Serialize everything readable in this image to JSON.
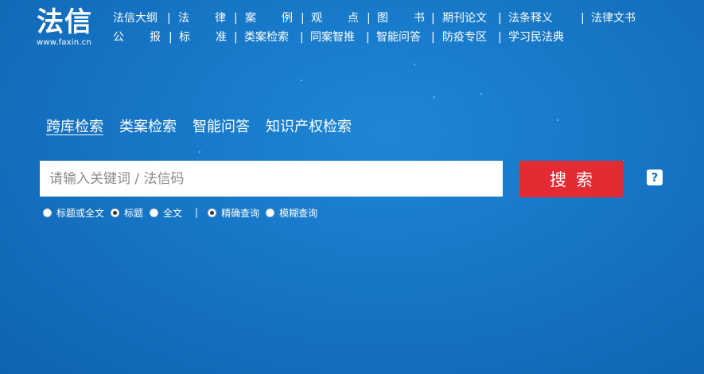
{
  "logo": {
    "title": "法信",
    "url": "www.faxin.cn"
  },
  "nav": {
    "row1": [
      {
        "label": "法信大纲",
        "sep": "|"
      },
      {
        "label": "法",
        "sep": ""
      },
      {
        "label": "律",
        "sep": "|"
      },
      {
        "label": "案",
        "sep": ""
      },
      {
        "label": "例",
        "sep": "|"
      },
      {
        "label": "观",
        "sep": ""
      },
      {
        "label": "点",
        "sep": "|"
      },
      {
        "label": "图",
        "sep": ""
      },
      {
        "label": "书",
        "sep": "|"
      },
      {
        "label": "期刊论文",
        "sep": "|"
      },
      {
        "label": "法条释义",
        "sep": "|"
      },
      {
        "label": "法律文书",
        "sep": ""
      }
    ],
    "row2": [
      {
        "label": "公",
        "sep": ""
      },
      {
        "label": "报",
        "sep": "|"
      },
      {
        "label": "标",
        "sep": ""
      },
      {
        "label": "准",
        "sep": "|"
      },
      {
        "label": "类案检索",
        "sep": "|"
      },
      {
        "label": "同案智推",
        "sep": "|"
      },
      {
        "label": "智能问答",
        "sep": "|"
      },
      {
        "label": "防疫专区",
        "sep": "|"
      },
      {
        "label": "学习民法典",
        "sep": ""
      }
    ]
  },
  "tabs": [
    "跨库检索",
    "类案检索",
    "智能问答",
    "知识产权检索"
  ],
  "search": {
    "placeholder": "请输入关键词 / 法信码",
    "value": "",
    "button": "搜索"
  },
  "help": "?",
  "options": {
    "scope": [
      {
        "label": "标题或全文",
        "checked": false
      },
      {
        "label": "标题",
        "checked": true
      },
      {
        "label": "全文",
        "checked": false
      }
    ],
    "separator": "|",
    "mode": [
      {
        "label": "精确查询",
        "checked": true
      },
      {
        "label": "模糊查询",
        "checked": false
      }
    ]
  }
}
